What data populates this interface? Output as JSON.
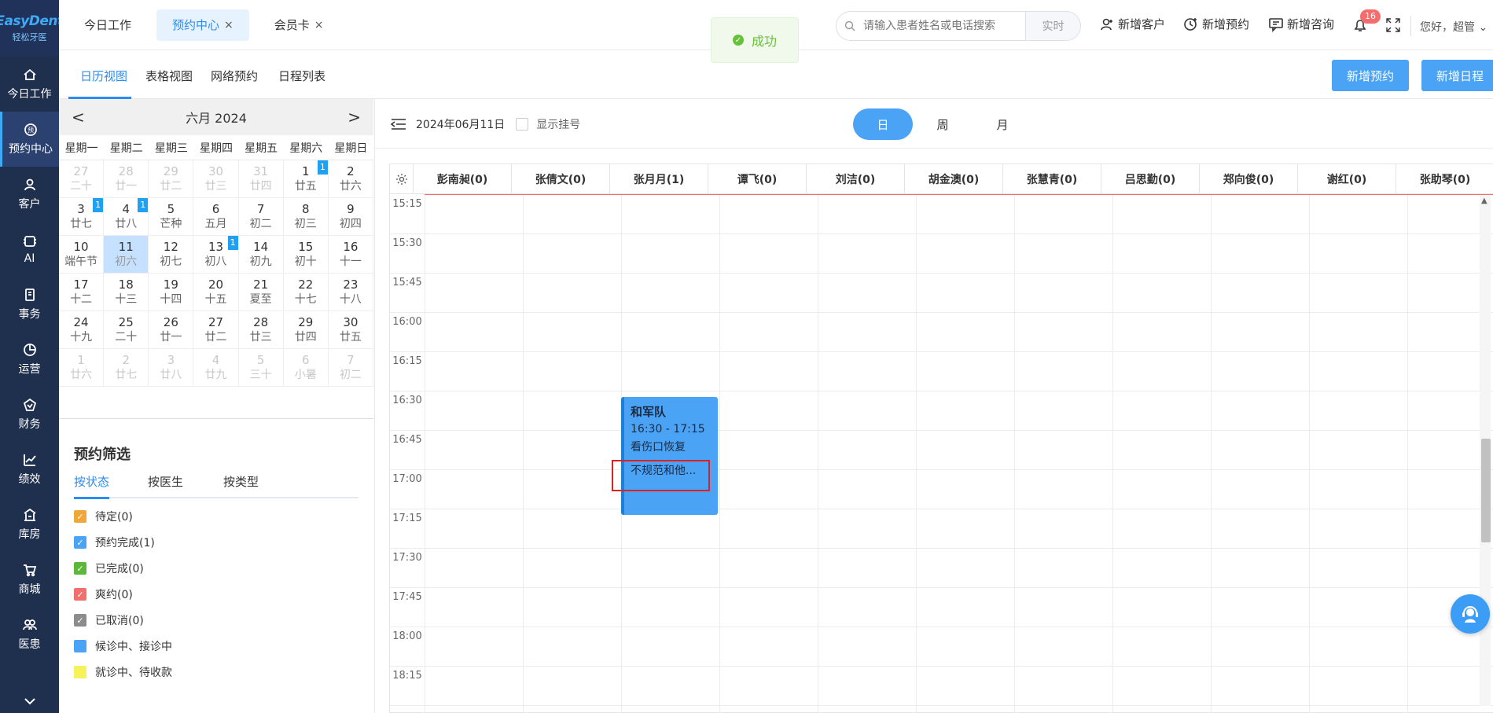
{
  "brand": {
    "name": "EasyDent",
    "sub": "轻松牙医"
  },
  "nav": [
    {
      "label": "今日工作",
      "icon": "home-icon"
    },
    {
      "label": "预约中心",
      "icon": "appointment-icon"
    },
    {
      "label": "客户",
      "icon": "user-icon"
    },
    {
      "label": "AI",
      "icon": "ai-icon"
    },
    {
      "label": "事务",
      "icon": "document-icon"
    },
    {
      "label": "运营",
      "icon": "pie-chart-icon"
    },
    {
      "label": "财务",
      "icon": "finance-icon"
    },
    {
      "label": "绩效",
      "icon": "trend-icon"
    },
    {
      "label": "库房",
      "icon": "warehouse-icon"
    },
    {
      "label": "商城",
      "icon": "cart-icon"
    },
    {
      "label": "医患",
      "icon": "doctor-patient-icon"
    }
  ],
  "top_tabs": [
    {
      "label": "今日工作"
    },
    {
      "label": "预约中心",
      "close": "×"
    },
    {
      "label": "会员卡",
      "close": "×"
    }
  ],
  "toast": {
    "text": "成功",
    "icon": "✓"
  },
  "search": {
    "placeholder": "请输入患者姓名或电话搜索",
    "mode": "实时"
  },
  "top_actions": {
    "add_customer": "新增客户",
    "add_appointment": "新增预约",
    "add_consult": "新增咨询"
  },
  "notifications": {
    "count": "16"
  },
  "greeting": "您好，超管",
  "sub_tabs": [
    "日历视图",
    "表格视图",
    "网络预约",
    "日程列表"
  ],
  "buttons": {
    "new_appointment": "新增预约",
    "new_schedule": "新增日程"
  },
  "calendar": {
    "title": "六月 2024",
    "prev": "<",
    "next": ">",
    "weekdays": [
      "星期一",
      "星期二",
      "星期三",
      "星期四",
      "星期五",
      "星期六",
      "星期日"
    ],
    "weeks": [
      [
        {
          "d": "27",
          "l": "二十",
          "m": true
        },
        {
          "d": "28",
          "l": "廿一",
          "m": true
        },
        {
          "d": "29",
          "l": "廿二",
          "m": true
        },
        {
          "d": "30",
          "l": "廿三",
          "m": true
        },
        {
          "d": "31",
          "l": "廿四",
          "m": true
        },
        {
          "d": "1",
          "l": "廿五",
          "c": "1"
        },
        {
          "d": "2",
          "l": "廿六"
        }
      ],
      [
        {
          "d": "3",
          "l": "廿七",
          "c": "1"
        },
        {
          "d": "4",
          "l": "廿八",
          "c": "1"
        },
        {
          "d": "5",
          "l": "芒种"
        },
        {
          "d": "6",
          "l": "五月"
        },
        {
          "d": "7",
          "l": "初二"
        },
        {
          "d": "8",
          "l": "初三"
        },
        {
          "d": "9",
          "l": "初四"
        }
      ],
      [
        {
          "d": "10",
          "l": "端午节"
        },
        {
          "d": "11",
          "l": "初六",
          "s": true
        },
        {
          "d": "12",
          "l": "初七"
        },
        {
          "d": "13",
          "l": "初八",
          "c": "1"
        },
        {
          "d": "14",
          "l": "初九"
        },
        {
          "d": "15",
          "l": "初十"
        },
        {
          "d": "16",
          "l": "十一"
        }
      ],
      [
        {
          "d": "17",
          "l": "十二"
        },
        {
          "d": "18",
          "l": "十三"
        },
        {
          "d": "19",
          "l": "十四"
        },
        {
          "d": "20",
          "l": "十五"
        },
        {
          "d": "21",
          "l": "夏至"
        },
        {
          "d": "22",
          "l": "十七"
        },
        {
          "d": "23",
          "l": "十八"
        }
      ],
      [
        {
          "d": "24",
          "l": "十九"
        },
        {
          "d": "25",
          "l": "二十"
        },
        {
          "d": "26",
          "l": "廿一"
        },
        {
          "d": "27",
          "l": "廿二"
        },
        {
          "d": "28",
          "l": "廿三"
        },
        {
          "d": "29",
          "l": "廿四"
        },
        {
          "d": "30",
          "l": "廿五"
        }
      ],
      [
        {
          "d": "1",
          "l": "廿六",
          "m": true
        },
        {
          "d": "2",
          "l": "廿七",
          "m": true
        },
        {
          "d": "3",
          "l": "廿八",
          "m": true
        },
        {
          "d": "4",
          "l": "廿九",
          "m": true
        },
        {
          "d": "5",
          "l": "三十",
          "m": true
        },
        {
          "d": "6",
          "l": "小暑",
          "m": true
        },
        {
          "d": "7",
          "l": "初二",
          "m": true
        }
      ]
    ]
  },
  "filter": {
    "title": "预约筛选",
    "tabs": [
      "按状态",
      "按医生",
      "按类型"
    ],
    "statuses": [
      {
        "label": "待定(0)",
        "color": "#f0a73a",
        "checked": true
      },
      {
        "label": "预约完成(1)",
        "color": "#4aa3f5",
        "checked": true
      },
      {
        "label": "已完成(0)",
        "color": "#5cb83a",
        "checked": true
      },
      {
        "label": "爽约(0)",
        "color": "#f07070",
        "checked": true
      },
      {
        "label": "已取消(0)",
        "color": "#8c8c8c",
        "checked": true
      },
      {
        "label": "候诊中、接诊中",
        "color": "#4aa3f5",
        "checked": false
      },
      {
        "label": "就诊中、待收款",
        "color": "#f7f25a",
        "checked": false
      }
    ]
  },
  "schedule": {
    "date": "2024年06月11日",
    "show_registration": "显示挂号",
    "views": [
      "日",
      "周",
      "月"
    ],
    "doctors": [
      "彭南昶(0)",
      "张倩文(0)",
      "张月月(1)",
      "谭飞(0)",
      "刘洁(0)",
      "胡金澳(0)",
      "张慧青(0)",
      "吕思勤(0)",
      "郑向俊(0)",
      "谢红(0)",
      "张助琴(0)"
    ],
    "times": [
      "15:15",
      "15:30",
      "15:45",
      "16:00",
      "16:15",
      "16:30",
      "16:45",
      "17:00",
      "17:15",
      "17:30",
      "17:45",
      "18:00",
      "18:15"
    ],
    "appointment": {
      "patient": "和军队",
      "time": "16:30 - 17:15",
      "item": "看伤口恢复",
      "note": "不规范和他..."
    }
  }
}
